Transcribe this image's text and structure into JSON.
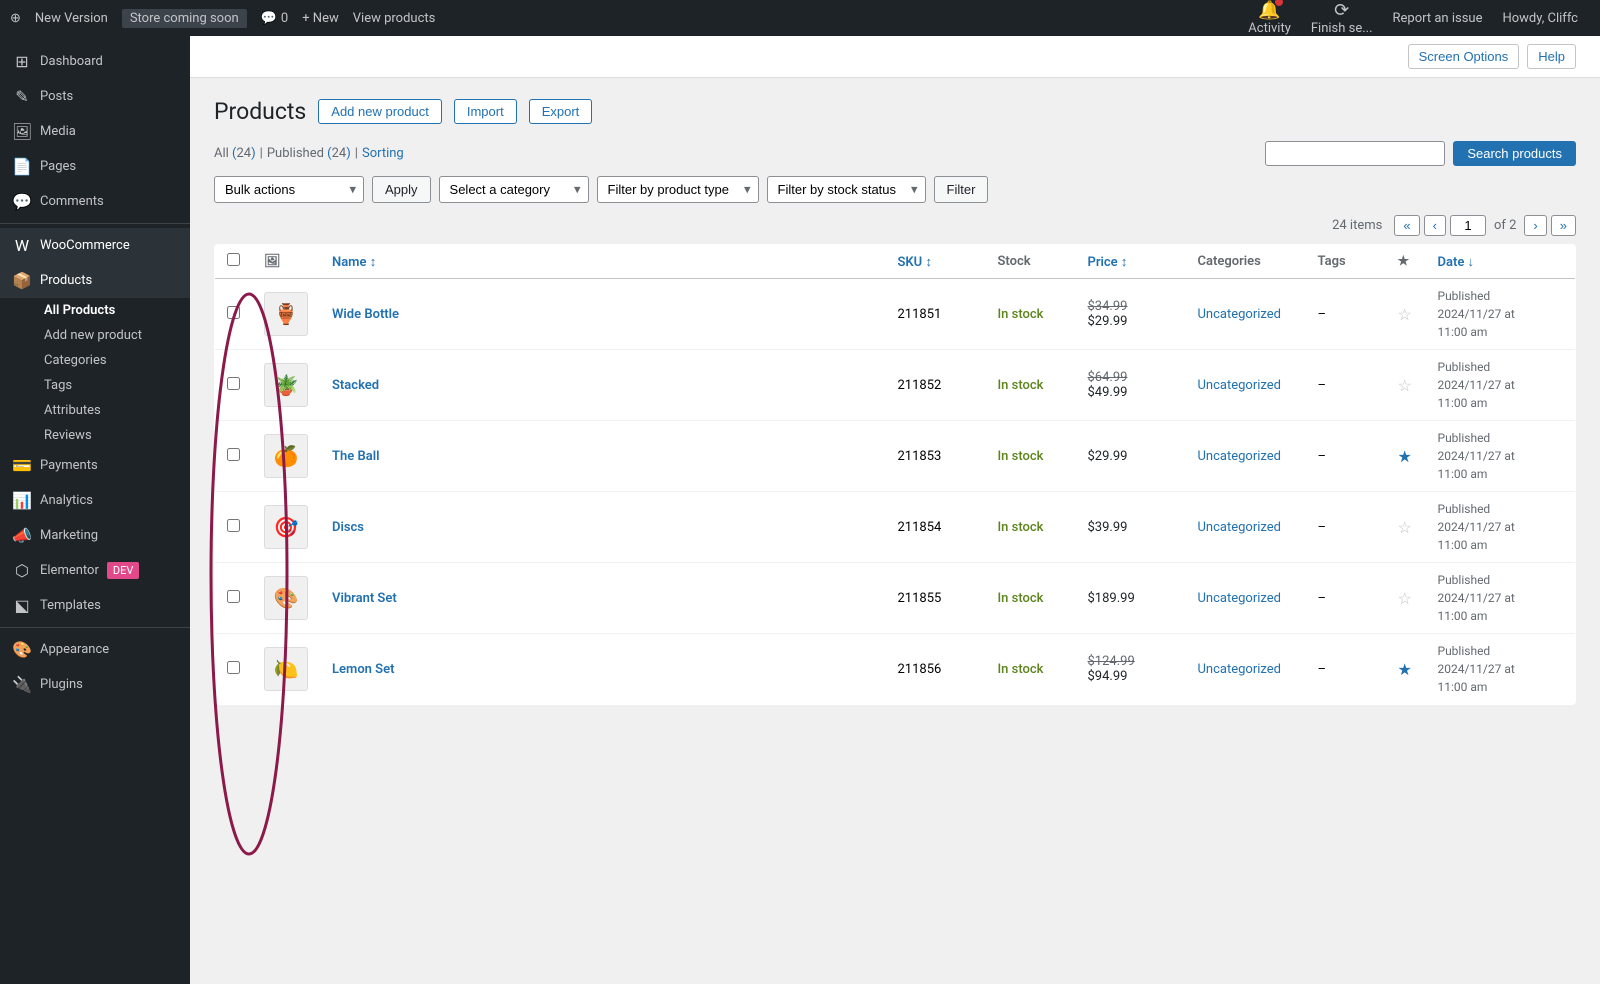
{
  "adminBar": {
    "siteName": "New Version",
    "storeBadge": "Store coming soon",
    "commentCount": "0",
    "newLabel": "+ New",
    "viewProducts": "View products",
    "reportIssue": "Report an issue",
    "howdy": "Howdy, Cliffc"
  },
  "topRightIcons": {
    "activity": "Activity",
    "finishSetup": "Finish se..."
  },
  "sidebar": {
    "dashboard": "Dashboard",
    "posts": "Posts",
    "media": "Media",
    "pages": "Pages",
    "comments": "Comments",
    "woocommerce": "WooCommerce",
    "products": "Products",
    "subItems": {
      "allProducts": "All Products",
      "addNewProduct": "Add new product",
      "categories": "Categories",
      "tags": "Tags",
      "attributes": "Attributes",
      "reviews": "Reviews"
    },
    "payments": "Payments",
    "analytics": "Analytics",
    "marketing": "Marketing",
    "elementor": "Elementor",
    "elementorBadge": "DEV",
    "templates": "Templates",
    "appearance": "Appearance",
    "plugins": "Plugins"
  },
  "screenOptions": "Screen Options",
  "help": "Help",
  "pageTitle": "Products",
  "buttons": {
    "addNewProduct": "Add new product",
    "import": "Import",
    "export": "Export",
    "apply": "Apply",
    "filter": "Filter",
    "searchProducts": "Search products"
  },
  "statusLinks": {
    "all": "All",
    "allCount": "24",
    "published": "Published",
    "publishedCount": "24",
    "sorting": "Sorting"
  },
  "filters": {
    "bulkActions": "Bulk actions",
    "selectCategory": "Select a category",
    "filterByProductType": "Filter by product type",
    "filterByStockStatus": "Filter by stock status"
  },
  "pagination": {
    "itemsCount": "24 items",
    "currentPage": "1",
    "totalPages": "2"
  },
  "tableHeaders": {
    "name": "Name",
    "sku": "SKU",
    "stock": "Stock",
    "price": "Price",
    "categories": "Categories",
    "tags": "Tags",
    "date": "Date"
  },
  "products": [
    {
      "id": 1,
      "name": "Wide Bottle",
      "sku": "211851",
      "stock": "In stock",
      "priceOriginal": "$34.99",
      "priceSale": "$29.99",
      "hasSale": true,
      "category": "Uncategorized",
      "tags": "–",
      "starred": false,
      "dateStatus": "Published",
      "date": "2024/11/27 at",
      "time": "11:00 am",
      "emoji": "🏺"
    },
    {
      "id": 2,
      "name": "Stacked",
      "sku": "211852",
      "stock": "In stock",
      "priceOriginal": "$64.99",
      "priceSale": "$49.99",
      "hasSale": true,
      "category": "Uncategorized",
      "tags": "–",
      "starred": false,
      "dateStatus": "Published",
      "date": "2024/11/27 at",
      "time": "11:00 am",
      "emoji": "🪴"
    },
    {
      "id": 3,
      "name": "The Ball",
      "sku": "211853",
      "stock": "In stock",
      "priceOriginal": "",
      "priceSale": "$29.99",
      "hasSale": false,
      "category": "Uncategorized",
      "tags": "–",
      "starred": true,
      "dateStatus": "Published",
      "date": "2024/11/27 at",
      "time": "11:00 am",
      "emoji": "🍊"
    },
    {
      "id": 4,
      "name": "Discs",
      "sku": "211854",
      "stock": "In stock",
      "priceOriginal": "",
      "priceSale": "$39.99",
      "hasSale": false,
      "category": "Uncategorized",
      "tags": "–",
      "starred": false,
      "dateStatus": "Published",
      "date": "2024/11/27 at",
      "time": "11:00 am",
      "emoji": "🎯"
    },
    {
      "id": 5,
      "name": "Vibrant Set",
      "sku": "211855",
      "stock": "In stock",
      "priceOriginal": "",
      "priceSale": "$189.99",
      "hasSale": false,
      "category": "Uncategorized",
      "tags": "–",
      "starred": false,
      "dateStatus": "Published",
      "date": "2024/11/27 at",
      "time": "11:00 am",
      "emoji": "🎨"
    },
    {
      "id": 6,
      "name": "Lemon Set",
      "sku": "211856",
      "stock": "In stock",
      "priceOriginal": "$124.99",
      "priceSale": "$94.99",
      "hasSale": true,
      "category": "Uncategorized",
      "tags": "–",
      "starred": true,
      "dateStatus": "Published",
      "date": "2024/11/27 at",
      "time": "11:00 am",
      "emoji": "🍋"
    }
  ]
}
